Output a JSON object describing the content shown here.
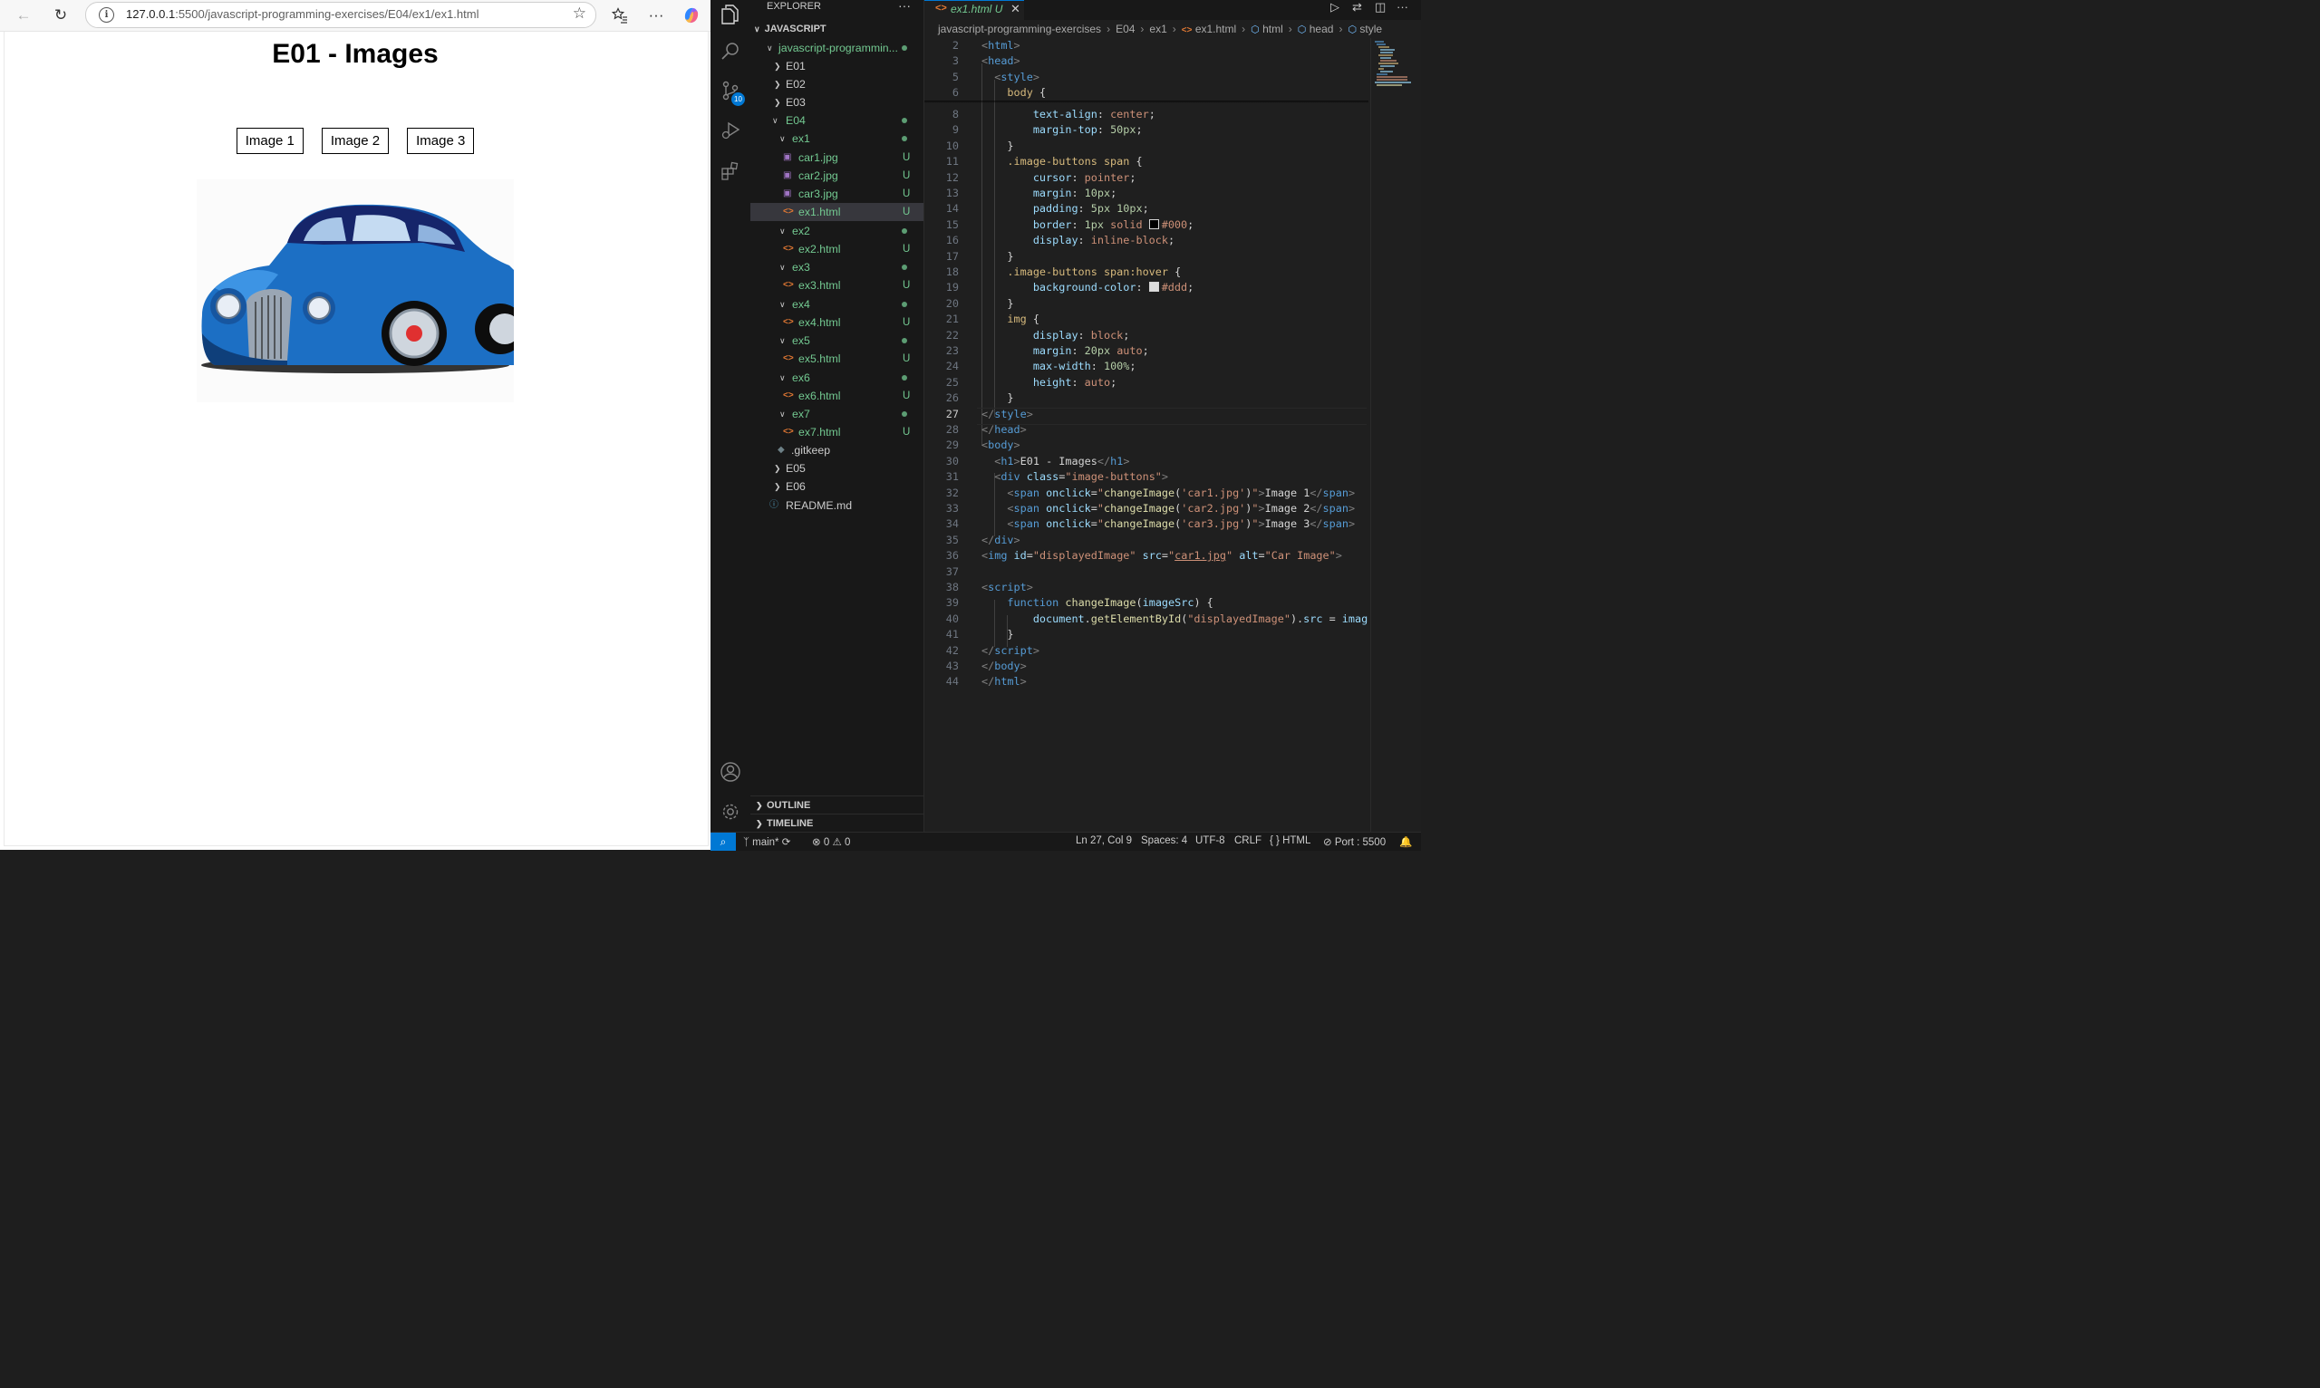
{
  "browser": {
    "address": {
      "host": "127.0.0.1",
      "path": ":5500/javascript-programming-exercises/E04/ex1/ex1.html"
    },
    "page": {
      "heading": "E01 - Images",
      "buttons": [
        "Image 1",
        "Image 2",
        "Image 3"
      ]
    }
  },
  "vscode": {
    "explorer": {
      "title": "EXPLORER",
      "more": "···",
      "section": "JAVASCRIPT",
      "root": "javascript-programmin...",
      "folders": {
        "e01": "E01",
        "e02": "E02",
        "e03": "E03",
        "e04": "E04",
        "ex1": "ex1",
        "ex2": "ex2",
        "ex3": "ex3",
        "ex4": "ex4",
        "ex5": "ex5",
        "ex6": "ex6",
        "ex7": "ex7",
        "e05": "E05",
        "e06": "E06"
      },
      "files": {
        "car1": "car1.jpg",
        "car2": "car2.jpg",
        "car3": "car3.jpg",
        "ex1html": "ex1.html",
        "ex2html": "ex2.html",
        "ex3html": "ex3.html",
        "ex4html": "ex4.html",
        "ex5html": "ex5.html",
        "ex6html": "ex6.html",
        "ex7html": "ex7.html",
        "gitkeep": ".gitkeep",
        "readme": "README.md"
      },
      "untracked": "U",
      "outline": "OUTLINE",
      "timeline": "TIMELINE"
    },
    "scm_badge": "10",
    "tab": {
      "name": "ex1.html",
      "status": "U"
    },
    "breadcrumb": {
      "root": "javascript-programming-exercises",
      "e04": "E04",
      "ex1": "ex1",
      "file": "ex1.html",
      "html": "html",
      "head": "head",
      "style": "style"
    },
    "status_bar": {
      "branch": "main*",
      "errors": "0",
      "warnings": "0",
      "position": "Ln 27, Col 9",
      "spaces": "Spaces: 4",
      "encoding": "UTF-8",
      "eol": "CRLF",
      "language": "HTML",
      "port": "Port : 5500"
    }
  }
}
